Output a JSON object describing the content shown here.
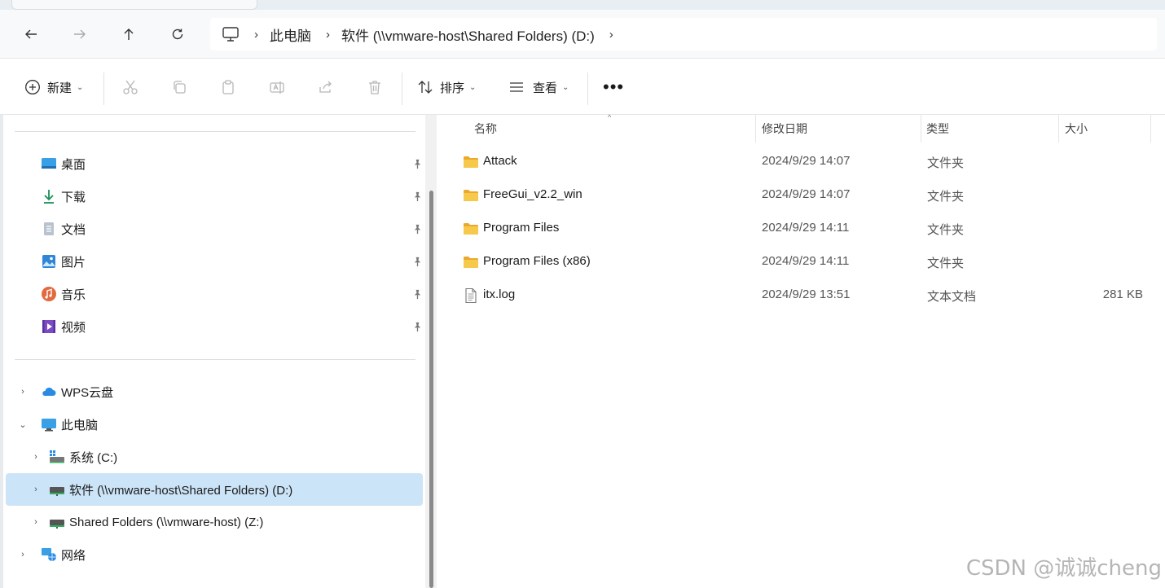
{
  "address": {
    "crumbs": [
      "此电脑",
      "软件 (\\\\vmware-host\\Shared Folders) (D:)"
    ]
  },
  "toolbar": {
    "new_label": "新建",
    "sort_label": "排序",
    "view_label": "查看"
  },
  "nav": {
    "quick_access": [
      {
        "label": "桌面",
        "icon": "desktop-icon"
      },
      {
        "label": "下载",
        "icon": "download-icon"
      },
      {
        "label": "文档",
        "icon": "document-icon"
      },
      {
        "label": "图片",
        "icon": "pictures-icon"
      },
      {
        "label": "音乐",
        "icon": "music-icon"
      },
      {
        "label": "视频",
        "icon": "videos-icon"
      }
    ],
    "tree": [
      {
        "label": "WPS云盘"
      },
      {
        "label": "此电脑"
      },
      {
        "label": "系统 (C:)"
      },
      {
        "label": "软件 (\\\\vmware-host\\Shared Folders) (D:)"
      },
      {
        "label": "Shared Folders (\\\\vmware-host) (Z:)"
      },
      {
        "label": "网络"
      }
    ]
  },
  "columns": {
    "name": "名称",
    "date": "修改日期",
    "type": "类型",
    "size": "大小"
  },
  "files": [
    {
      "name": "Attack",
      "date": "2024/9/29 14:07",
      "type": "文件夹",
      "size": ""
    },
    {
      "name": "FreeGui_v2.2_win",
      "date": "2024/9/29 14:07",
      "type": "文件夹",
      "size": ""
    },
    {
      "name": "Program Files",
      "date": "2024/9/29 14:11",
      "type": "文件夹",
      "size": ""
    },
    {
      "name": "Program Files (x86)",
      "date": "2024/9/29 14:11",
      "type": "文件夹",
      "size": ""
    },
    {
      "name": "itx.log",
      "date": "2024/9/29 13:51",
      "type": "文本文档",
      "size": "281 KB"
    }
  ],
  "watermark": "CSDN @诚诚cheng",
  "colors": {
    "selected_bg": "#cce4f7",
    "folder_yellow": "#f5c242",
    "accent": "#0067c0"
  }
}
